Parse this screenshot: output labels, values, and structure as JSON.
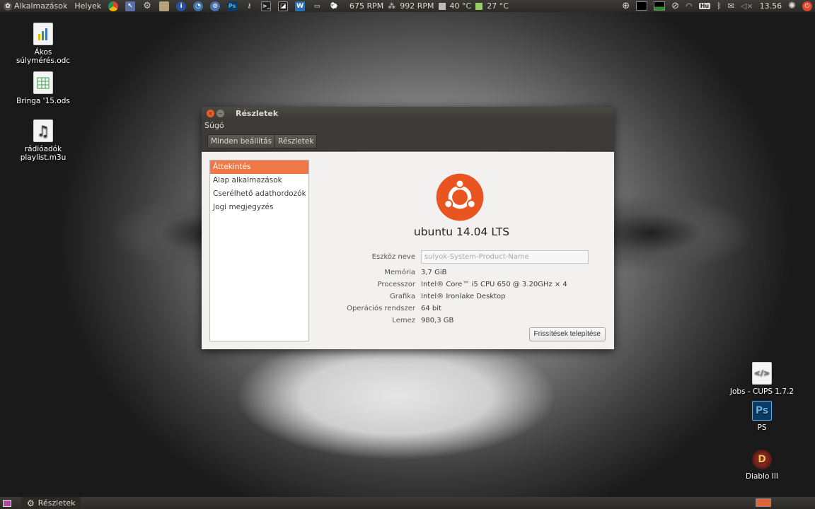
{
  "top_panel": {
    "menu_apps": "Alkalmazások",
    "menu_places": "Helyek",
    "fan1": "675 RPM",
    "fan2": "992 RPM",
    "temp1": "40 °C",
    "temp2": "27 °C",
    "keyboard_layout": "Hu",
    "clock": "13.56"
  },
  "desktop_icons": [
    {
      "label": "Ákos súlymérés.odc"
    },
    {
      "label": "Bringa '15.ods"
    },
    {
      "label": "rádióadók playlist.m3u"
    },
    {
      "label": "Jobs - CUPS 1.7.2"
    },
    {
      "label": "PS"
    },
    {
      "label": "Diablo III"
    }
  ],
  "dialog": {
    "title": "Részletek",
    "menu_help": "Súgó",
    "breadcrumb": [
      "Minden beállítás",
      "Részletek"
    ],
    "sidebar": [
      "Áttekintés",
      "Alap alkalmazások",
      "Cserélhető adathordozók",
      "Jogi megjegyzés"
    ],
    "os_name": "ubuntu 14.04 LTS",
    "device_label": "Eszköz neve",
    "device_value": "sulyok-System-Product-Name",
    "memory_label": "Memória",
    "memory_value": "3,7 GiB",
    "cpu_label": "Processzor",
    "cpu_value": "Intel® Core™ i5 CPU 650 @ 3.20GHz × 4",
    "gpu_label": "Grafika",
    "gpu_value": "Intel® Ironlake Desktop",
    "os_type_label": "Operációs rendszer",
    "os_type_value": "64 bit",
    "disk_label": "Lemez",
    "disk_value": "980,3 GB",
    "update_button": "Frissítések telepítése"
  },
  "bottom_panel": {
    "task_label": "Részletek"
  },
  "colors": {
    "accent": "#f07746",
    "ubuntu_orange": "#e95420",
    "panel": "#3c3b37"
  }
}
